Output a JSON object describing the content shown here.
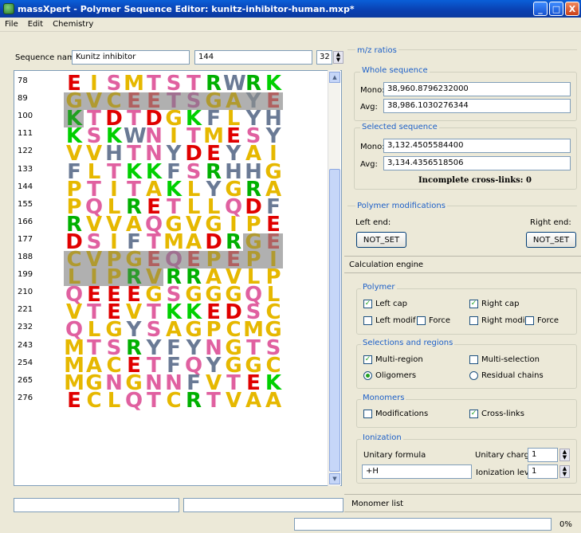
{
  "window": {
    "title": "massXpert - Polymer Sequence Editor: kunitz-inhibitor-human.mxp*",
    "min": "_",
    "max": "□",
    "close": "X"
  },
  "menu": [
    "File",
    "Edit",
    "Chemistry"
  ],
  "sequence_header": {
    "name_label": "Sequence name:",
    "name_value": "Kunitz inhibitor",
    "length_value": "144",
    "spin_value": "32"
  },
  "rows": [
    {
      "num": "78",
      "seq": "EISMTSTRWRK",
      "sel": []
    },
    {
      "num": "89",
      "seq": "GVCEETSGAYE",
      "sel": [
        0,
        1,
        2,
        3,
        4,
        5,
        6,
        7,
        8,
        9,
        10
      ]
    },
    {
      "num": "100",
      "seq": "KTDTDGKFLYH",
      "sel": [
        0
      ]
    },
    {
      "num": "111",
      "seq": "KSKWNITMESY",
      "sel": []
    },
    {
      "num": "122",
      "seq": "VVHTNYDEYAI",
      "sel": []
    },
    {
      "num": "133",
      "seq": "FLTKKFSRHHG",
      "sel": []
    },
    {
      "num": "144",
      "seq": "PTITAKLYGRA",
      "sel": []
    },
    {
      "num": "155",
      "seq": "PQLRETLLQDF",
      "sel": []
    },
    {
      "num": "166",
      "seq": "RVVAQGVGIPE",
      "sel": []
    },
    {
      "num": "177",
      "seq": "DSIFTMADRGE",
      "sel": [
        9,
        10
      ]
    },
    {
      "num": "188",
      "seq": "CVPGEQEPEPI",
      "sel": [
        0,
        1,
        2,
        3,
        4,
        5,
        6,
        7,
        8,
        9,
        10
      ]
    },
    {
      "num": "199",
      "seq": "LIPRVRRAVLP",
      "sel": [
        0,
        1,
        2,
        3,
        4
      ]
    },
    {
      "num": "210",
      "seq": "QEEEGSGGGQL",
      "sel": []
    },
    {
      "num": "221",
      "seq": "VTEVTKKEDSC",
      "sel": []
    },
    {
      "num": "232",
      "seq": "QLGYSAGPCMG",
      "sel": []
    },
    {
      "num": "243",
      "seq": "MTSRYFYNGTS",
      "sel": []
    },
    {
      "num": "254",
      "seq": "MACETFQYGGC",
      "sel": []
    },
    {
      "num": "265",
      "seq": "MGNGNNFVTEK",
      "sel": []
    },
    {
      "num": "276",
      "seq": "ECLQTCRTVAA",
      "sel": []
    }
  ],
  "colors": {
    "A": "#e6b800",
    "C": "#e6b800",
    "D": "#e00000",
    "E": "#e00000",
    "F": "#6a7a95",
    "G": "#e6b800",
    "H": "#6a7a95",
    "I": "#e6b800",
    "K": "#00d000",
    "L": "#e6b800",
    "M": "#e6b800",
    "N": "#e060a0",
    "P": "#e6b800",
    "Q": "#e060a0",
    "R": "#00b000",
    "S": "#e060a0",
    "T": "#e060a0",
    "V": "#e6b800",
    "W": "#6a7a95",
    "Y": "#6a7a95"
  },
  "selected_colors": {
    "G": "#b09a30",
    "V": "#b09a30",
    "C": "#b09a30",
    "E": "#b06060",
    "T": "#a07090",
    "S": "#a07090",
    "A": "#b09a30",
    "Y": "#808890",
    "K": "#20a020",
    "R": "#2d9a2d",
    "P": "#b09a30",
    "Q": "#a07090",
    "I": "#b09a30",
    "L": "#b09a30"
  },
  "mz": {
    "section": "m/z ratios",
    "whole_title": "Whole sequence",
    "whole_mono_label": "Mono:",
    "whole_mono": "38,960.8796232000",
    "whole_avg_label": "Avg:",
    "whole_avg": "38,986.1030276344",
    "sel_title": "Selected sequence",
    "sel_mono_label": "Mono:",
    "sel_mono": "3,132.4505584400",
    "sel_avg_label": "Avg:",
    "sel_avg": "3,134.4356518506",
    "crosslinks": "Incomplete cross-links: 0"
  },
  "polymods": {
    "title": "Polymer modifications",
    "left_label": "Left end:",
    "right_label": "Right end:",
    "left_btn": "NOT_SET",
    "right_btn": "NOT_SET"
  },
  "calc": {
    "title": "Calculation engine",
    "polymer_title": "Polymer",
    "left_cap": "Left cap",
    "right_cap": "Right cap",
    "left_modif": "Left modif",
    "force1": "Force",
    "right_modif": "Right modif",
    "force2": "Force",
    "regions_title": "Selections and regions",
    "multi_region": "Multi-region",
    "multi_selection": "Multi-selection",
    "oligomers": "Oligomers",
    "residual_chains": "Residual chains",
    "monomers_title": "Monomers",
    "modifications": "Modifications",
    "cross_links": "Cross-links",
    "ionization_title": "Ionization",
    "unitary_formula_label": "Unitary formula",
    "unitary_formula": "+H",
    "unitary_charge_label": "Unitary charge",
    "unitary_charge": "1",
    "ionization_level_label": "Ionization level",
    "ionization_level": "1"
  },
  "bottom": {
    "monomer_list": "Monomer list",
    "progress": "0%"
  }
}
